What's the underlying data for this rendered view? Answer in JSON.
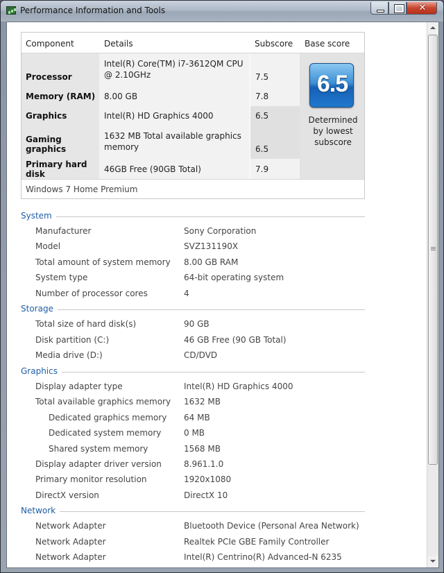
{
  "window": {
    "title": "Performance Information and Tools",
    "close_glyph": "✕"
  },
  "score_table": {
    "headers": {
      "component": "Component",
      "details": "Details",
      "subscore": "Subscore",
      "base_score": "Base score"
    },
    "rows": [
      {
        "component": "Processor",
        "details": "Intel(R) Core(TM) i7-3612QM CPU @ 2.10GHz",
        "subscore": "7.5"
      },
      {
        "component": "Memory (RAM)",
        "details": "8.00 GB",
        "subscore": "7.8"
      },
      {
        "component": "Graphics",
        "details": "Intel(R) HD Graphics 4000",
        "subscore": "6.5"
      },
      {
        "component": "Gaming graphics",
        "details": "1632 MB Total available graphics memory",
        "subscore": "6.5"
      },
      {
        "component": "Primary hard disk",
        "details": "46GB Free (90GB Total)",
        "subscore": "7.9"
      }
    ],
    "base_score": "6.5",
    "base_note": "Determined by lowest subscore",
    "os_edition": "Windows 7 Home Premium"
  },
  "sections": {
    "system": {
      "title": "System",
      "rows": [
        {
          "label": "Manufacturer",
          "value": "Sony Corporation"
        },
        {
          "label": "Model",
          "value": "SVZ131190X"
        },
        {
          "label": "Total amount of system memory",
          "value": "8.00 GB RAM"
        },
        {
          "label": "System type",
          "value": "64-bit operating system"
        },
        {
          "label": "Number of processor cores",
          "value": "4"
        }
      ]
    },
    "storage": {
      "title": "Storage",
      "rows": [
        {
          "label": "Total size of hard disk(s)",
          "value": "90 GB"
        },
        {
          "label": "Disk partition (C:)",
          "value": "46 GB Free (90 GB Total)"
        },
        {
          "label": "Media drive (D:)",
          "value": "CD/DVD"
        }
      ]
    },
    "graphics": {
      "title": "Graphics",
      "rows": [
        {
          "label": "Display adapter type",
          "value": "Intel(R) HD Graphics 4000"
        },
        {
          "label": "Total available graphics memory",
          "value": "1632 MB"
        },
        {
          "label": "Dedicated graphics memory",
          "value": "64 MB"
        },
        {
          "label": "Dedicated system memory",
          "value": "0 MB"
        },
        {
          "label": "Shared system memory",
          "value": "1568 MB"
        },
        {
          "label": "Display adapter driver version",
          "value": "8.961.1.0"
        },
        {
          "label": "Primary monitor resolution",
          "value": "1920x1080"
        },
        {
          "label": "DirectX version",
          "value": "DirectX 10"
        }
      ]
    },
    "network": {
      "title": "Network",
      "rows": [
        {
          "label": "Network Adapter",
          "value": "Bluetooth Device (Personal Area Network)"
        },
        {
          "label": "Network Adapter",
          "value": "Realtek PCIe GBE Family Controller"
        },
        {
          "label": "Network Adapter",
          "value": "Intel(R) Centrino(R) Advanced-N 6235"
        }
      ]
    }
  }
}
